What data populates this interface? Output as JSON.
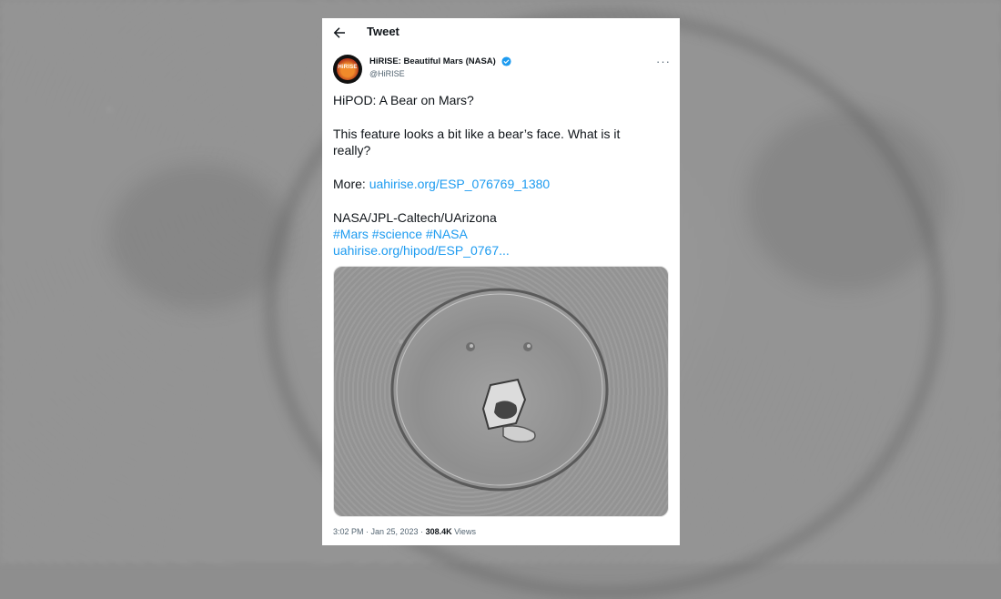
{
  "header": {
    "title": "Tweet"
  },
  "author": {
    "avatar_text": "HiRISE",
    "name": "HiRISE: Beautiful Mars (NASA)",
    "handle": "@HiRISE"
  },
  "tweet": {
    "line1": "HiPOD: A Bear on Mars?",
    "line2": "This feature looks a bit like a bear’s face. What is it",
    "line3": "really?",
    "more_label": "More: ",
    "more_link": "uahirise.org/ESP_076769_1380",
    "credit": "NASA/JPL-Caltech/UArizona",
    "hashtags": "#Mars #science #NASA",
    "link2": "uahirise.org/hipod/ESP_0767..."
  },
  "footer": {
    "time": "3:02 PM · Jan 25, 2023 · ",
    "views_count": "308.4K",
    "views_label": " Views"
  },
  "icons": [
    "back-arrow-icon",
    "verified-badge-icon",
    "more-options-icon"
  ],
  "colors": {
    "link": "#1d9bf0",
    "verified": "#1d9bf0",
    "text": "#0f1419",
    "muted": "#536471"
  }
}
